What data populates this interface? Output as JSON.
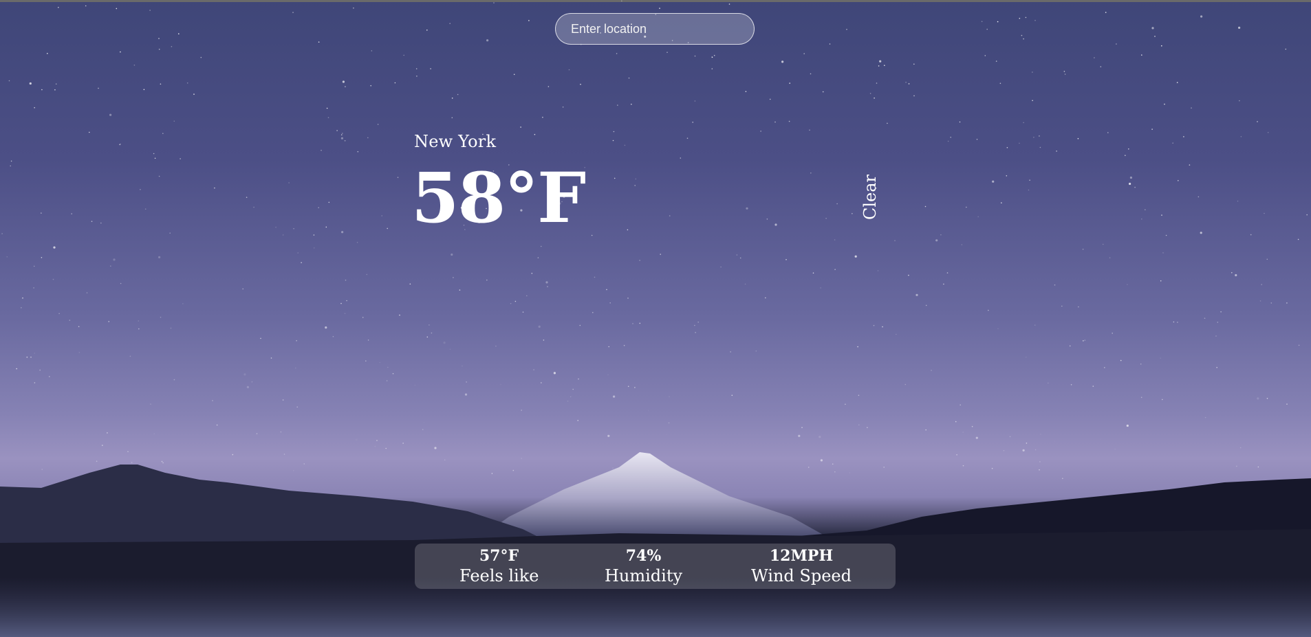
{
  "search": {
    "placeholder": "Enter location"
  },
  "weather": {
    "city": "New York",
    "temperature": "58°F",
    "condition": "Clear"
  },
  "details": {
    "feels_like_value": "57°F",
    "feels_like_label": "Feels like",
    "humidity_value": "74%",
    "humidity_label": "Humidity",
    "wind_value": "12MPH",
    "wind_label": "Wind Speed"
  },
  "colors": {
    "sky_top": "#3f4678",
    "sky_horizon": "#9a92c0",
    "mountains": "#1a1b2a",
    "text": "#ffffff"
  }
}
